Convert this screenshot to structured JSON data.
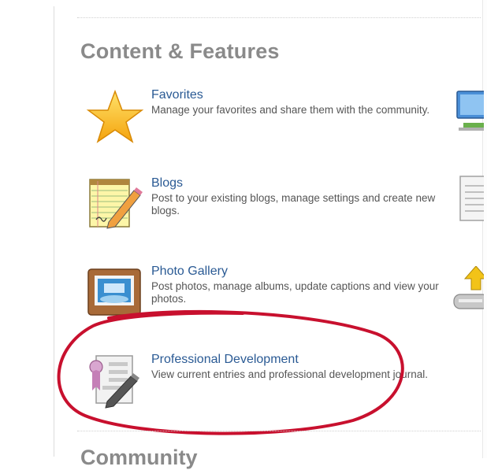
{
  "section": {
    "title": "Content & Features",
    "next_title": "Community"
  },
  "features": [
    {
      "name": "Favorites",
      "description": "Manage your favorites and share them with the community.",
      "icon": "star-icon"
    },
    {
      "name": "Blogs",
      "description": "Post to your existing blogs, manage settings and create new blogs.",
      "icon": "notepad-pencil-icon"
    },
    {
      "name": "Photo Gallery",
      "description": "Post photos, manage albums, update captions and view your photos.",
      "icon": "photo-frame-icon"
    },
    {
      "name": "Professional Development",
      "description": "View current entries and professional development journal.",
      "icon": "certificate-pencil-icon"
    }
  ],
  "edge_icons": [
    "computer-icon",
    "document-icon",
    "upload-drive-icon"
  ],
  "colors": {
    "link": "#2a5a94",
    "heading": "#8a8a8a",
    "highlight": "#c8102e"
  }
}
